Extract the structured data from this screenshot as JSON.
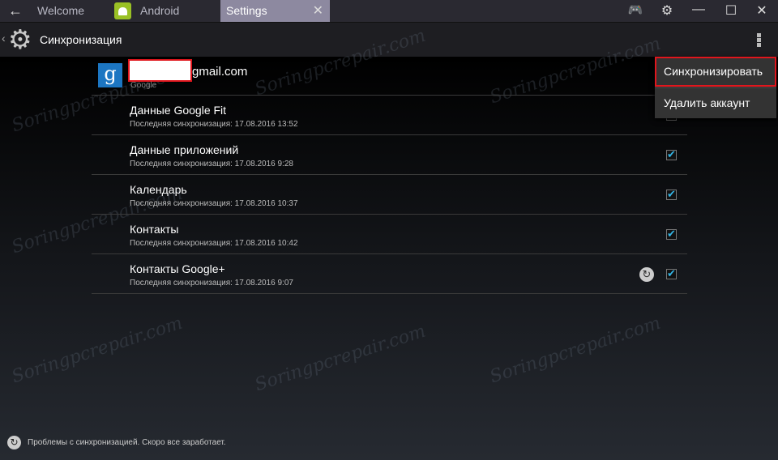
{
  "titlebar": {
    "tabs": [
      {
        "label": "Welcome"
      },
      {
        "label": "Android"
      },
      {
        "label": "Settings"
      }
    ],
    "close_tab": "✕",
    "controls": {
      "gamepad": "🎮",
      "settings": "⚙",
      "minimize": "—",
      "maximize": "☐",
      "close": "✕"
    }
  },
  "actionbar": {
    "title": "Синхронизация"
  },
  "account": {
    "email_suffix": "gmail.com",
    "provider": "Google",
    "icon_letter": "g"
  },
  "items": [
    {
      "title": "Данные Google Fit",
      "subtitle": "Последняя синхронизация: 17.08.2016 13:52",
      "checked": true
    },
    {
      "title": "Данные приложений",
      "subtitle": "Последняя синхронизация: 17.08.2016 9:28",
      "checked": true
    },
    {
      "title": "Календарь",
      "subtitle": "Последняя синхронизация: 17.08.2016 10:37",
      "checked": true
    },
    {
      "title": "Контакты",
      "subtitle": "Последняя синхронизация: 17.08.2016 10:42",
      "checked": true
    },
    {
      "title": "Контакты Google+",
      "subtitle": "Последняя синхронизация: 17.08.2016 9:07",
      "checked": true,
      "syncing": true
    }
  ],
  "menu": {
    "items": [
      {
        "label": "Синхронизировать"
      },
      {
        "label": "Удалить аккаунт"
      }
    ]
  },
  "status": {
    "text": "Проблемы с синхронизацией. Скоро все заработает."
  },
  "watermark": "Soringpcrepair.com",
  "colors": {
    "accent": "#33b5e5",
    "highlight": "#e0161d",
    "tab_active": "#8d89a0"
  }
}
